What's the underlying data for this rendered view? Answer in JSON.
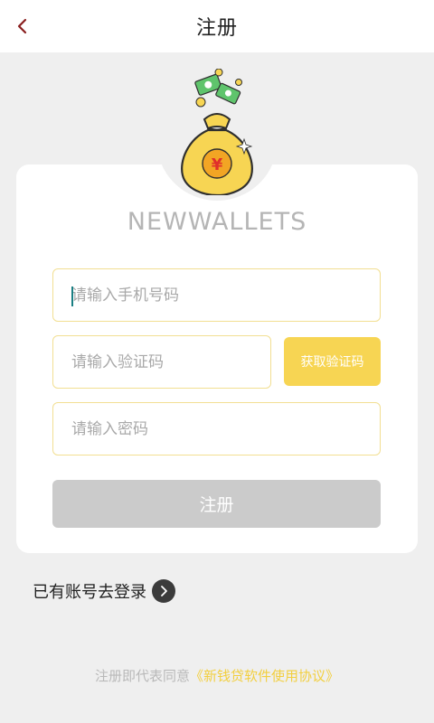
{
  "header": {
    "title": "注册",
    "back_icon": "chevron-left-icon"
  },
  "brand": "NEWWALLETS",
  "mascot_icon": "money-bag-icon",
  "form": {
    "phone_placeholder": "请输入手机号码",
    "code_placeholder": "请输入验证码",
    "get_code_label": "获取验证码",
    "password_placeholder": "请输入密码",
    "submit_label": "注册"
  },
  "login": {
    "text": "已有账号去登录",
    "icon": "chevron-right-icon"
  },
  "agreement": {
    "prefix": "注册即代表同意",
    "link": "《新钱贷软件使用协议》"
  },
  "colors": {
    "accent": "#f7d553",
    "field_border": "#f2df92",
    "disabled_button": "#cbcbcb",
    "link": "#f2cf3f",
    "background": "#efefef"
  }
}
